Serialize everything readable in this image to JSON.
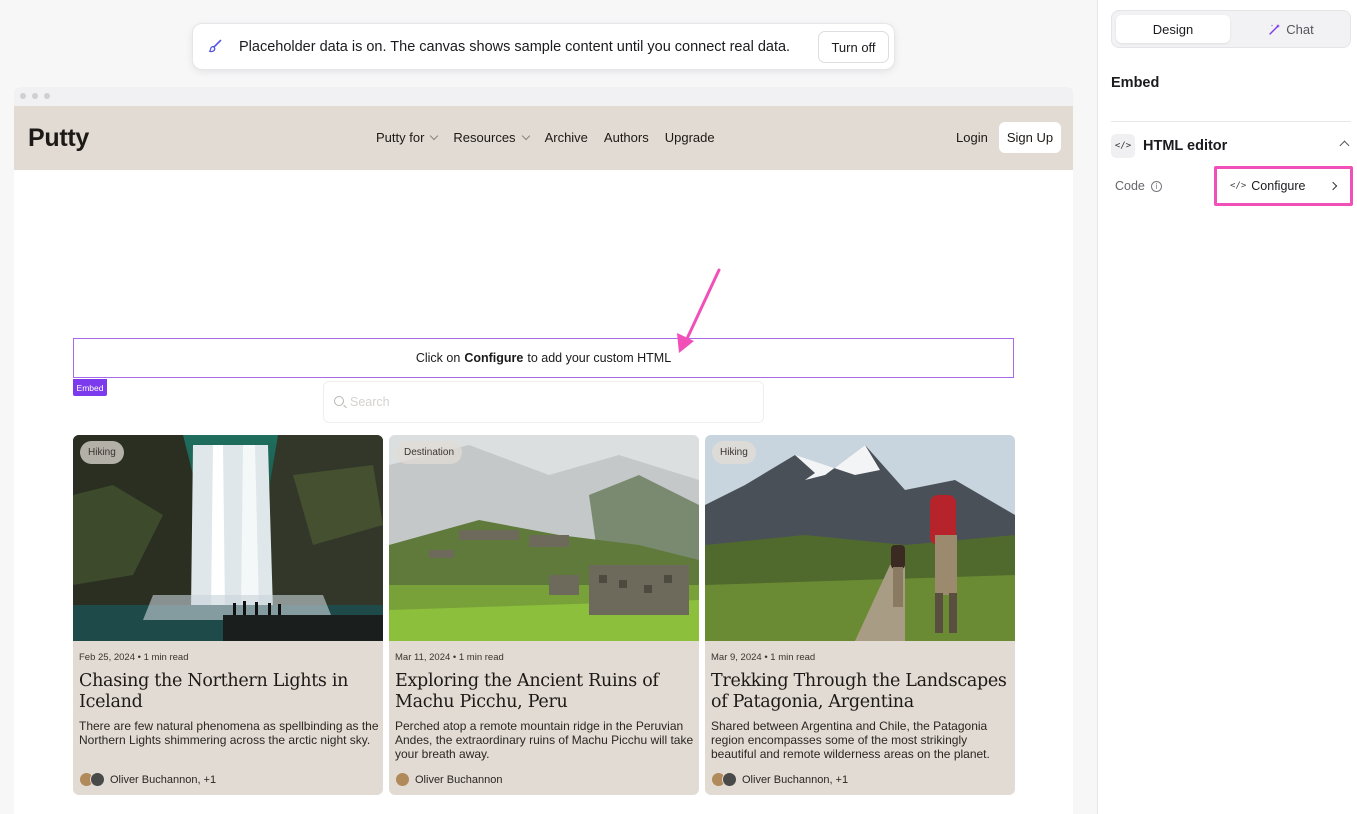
{
  "toast": {
    "message": "Placeholder data is on. The canvas shows sample content until you connect real data.",
    "button": "Turn off"
  },
  "site": {
    "logo": "Putty",
    "nav": [
      "Putty for",
      "Resources",
      "Archive",
      "Authors",
      "Upgrade"
    ],
    "login": "Login",
    "signup": "Sign Up"
  },
  "embed": {
    "prefix": "Click on",
    "bold": "Configure",
    "suffix": "to add your custom HTML",
    "tag": "Embed"
  },
  "search": {
    "placeholder": "Search"
  },
  "cards": [
    {
      "tag": "Hiking",
      "meta": "Feb 25, 2024 • 1 min read",
      "title": "Chasing the Northern Lights in Iceland",
      "excerpt": "There are few natural phenomena as spellbinding as the Northern Lights shimmering across the arctic night sky.",
      "author": "Oliver Buchannon, +1"
    },
    {
      "tag": "Destination",
      "meta": "Mar 11, 2024 • 1 min read",
      "title": "Exploring the Ancient Ruins of Machu Picchu, Peru",
      "excerpt": "Perched atop a remote mountain ridge in the Peruvian Andes, the extraordinary ruins of Machu Picchu will take your breath away.",
      "author": "Oliver Buchannon"
    },
    {
      "tag": "Hiking",
      "meta": "Mar 9, 2024 • 1 min read",
      "title": "Trekking Through the Landscapes of Patagonia, Argentina",
      "excerpt": "Shared between Argentina and Chile, the Patagonia region encompasses some of the most strikingly beautiful and remote wilderness areas on the planet.",
      "author": "Oliver Buchannon, +1"
    }
  ],
  "panel": {
    "tab_design": "Design",
    "tab_chat": "Chat",
    "title": "Embed",
    "section_title": "HTML editor",
    "code_label": "Code",
    "configure_label": "Configure"
  },
  "colors": {
    "accent_purple": "#7c3aed",
    "highlight_pink": "#f050b8",
    "header_beige": "#e2dbd3"
  }
}
